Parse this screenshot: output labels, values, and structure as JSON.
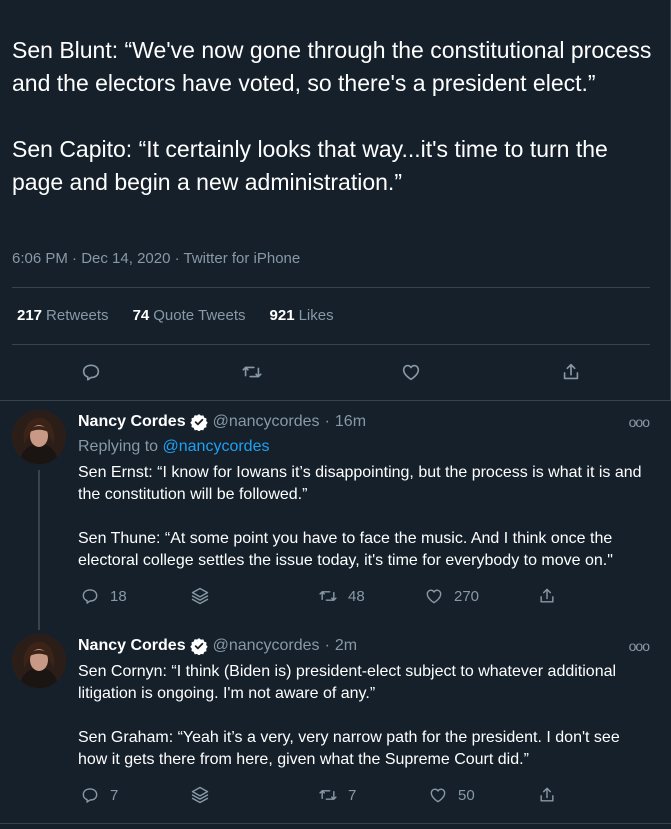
{
  "tweet": {
    "paragraphs": [
      "Sen Blunt: “We've now gone through the constitutional process and the electors have voted, so there's a president elect.”",
      "Sen Capito: “It certainly looks that way...it's time to turn the page and begin a new administration.”"
    ],
    "time": "6:06 PM",
    "date": "Dec 14, 2020",
    "source": "Twitter for iPhone",
    "retweets": "217",
    "retweets_label": "Retweets",
    "quotes": "74",
    "quotes_label": "Quote Tweets",
    "likes": "921",
    "likes_label": "Likes"
  },
  "replies": [
    {
      "name": "Nancy Cordes",
      "handle": "@nancycordes",
      "time": "16m",
      "replying_prefix": "Replying to",
      "replying_to": "@nancycordes",
      "paragraphs": [
        "Sen Ernst: “I know for Iowans it’s disappointing, but the process is what it is and the constitution will be followed.”",
        "Sen Thune: “At some point you have to face the music. And I think once the electoral college settles the issue today, it's time for everybody to move on.\""
      ],
      "reply_count": "18",
      "retweet_count": "48",
      "like_count": "270"
    },
    {
      "name": "Nancy Cordes",
      "handle": "@nancycordes",
      "time": "2m",
      "paragraphs": [
        "Sen Cornyn: “I think (Biden is) president-elect subject to whatever additional litigation is ongoing. I'm not aware of any.”",
        "Sen Graham: “Yeah it’s a very, very narrow path for the president. I don't see how it gets there from here, given what the Supreme Court did.”"
      ],
      "reply_count": "7",
      "retweet_count": "7",
      "like_count": "50"
    }
  ],
  "colors": {
    "background": "#15202b",
    "secondary_text": "#8899a6",
    "link": "#1da1f2",
    "divider": "#38444d"
  },
  "icons": [
    "reply-icon",
    "retweet-icon",
    "like-icon",
    "share-icon",
    "stack-icon",
    "verified-icon",
    "more-icon"
  ]
}
